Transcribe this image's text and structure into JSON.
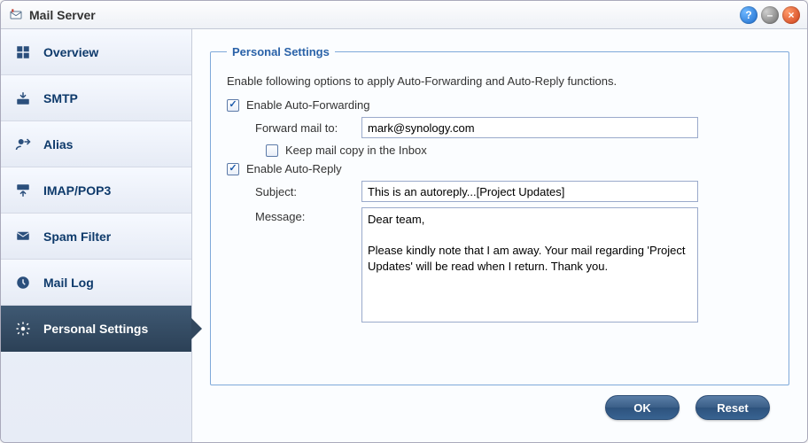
{
  "window": {
    "title": "Mail Server"
  },
  "sidebar": {
    "items": [
      {
        "label": "Overview",
        "icon": "overview-icon",
        "active": false
      },
      {
        "label": "SMTP",
        "icon": "smtp-icon",
        "active": false
      },
      {
        "label": "Alias",
        "icon": "alias-icon",
        "active": false
      },
      {
        "label": "IMAP/POP3",
        "icon": "imap-pop3-icon",
        "active": false
      },
      {
        "label": "Spam Filter",
        "icon": "spam-filter-icon",
        "active": false
      },
      {
        "label": "Mail Log",
        "icon": "mail-log-icon",
        "active": false
      },
      {
        "label": "Personal Settings",
        "icon": "personal-settings-icon",
        "active": true
      }
    ]
  },
  "panel": {
    "legend": "Personal Settings",
    "description": "Enable following options to apply Auto-Forwarding and Auto-Reply functions.",
    "enable_forwarding_label": "Enable Auto-Forwarding",
    "enable_forwarding_checked": true,
    "forward_to_label": "Forward mail to:",
    "forward_to_value": "mark@synology.com",
    "keep_copy_label": "Keep mail copy in the Inbox",
    "keep_copy_checked": false,
    "enable_autoreply_label": "Enable Auto-Reply",
    "enable_autoreply_checked": true,
    "subject_label": "Subject:",
    "subject_value": "This is an autoreply...[Project Updates]",
    "message_label": "Message:",
    "message_value": "Dear team,\n\nPlease kindly note that I am away. Your mail regarding 'Project Updates' will be read when I return. Thank you."
  },
  "buttons": {
    "ok": "OK",
    "reset": "Reset"
  }
}
